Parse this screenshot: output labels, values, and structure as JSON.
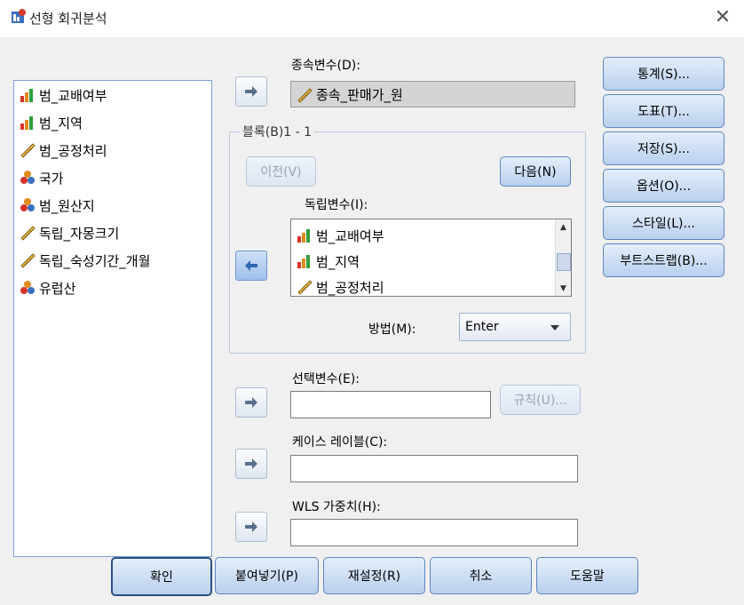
{
  "window": {
    "title": "선형 회귀분석",
    "close_glyph": "✕"
  },
  "source_variables": [
    {
      "label": "범_교배여부",
      "icon": "nominal-bar-icon"
    },
    {
      "label": "범_지역",
      "icon": "nominal-bar-icon"
    },
    {
      "label": "범_공정처리",
      "icon": "scale-ruler-icon"
    },
    {
      "label": "국가",
      "icon": "nominal-circles-icon"
    },
    {
      "label": "범_원산지",
      "icon": "nominal-circles-icon"
    },
    {
      "label": "독립_자몽크기",
      "icon": "scale-ruler-icon"
    },
    {
      "label": "독립_숙성기간_개월",
      "icon": "scale-ruler-icon"
    },
    {
      "label": "유럽산",
      "icon": "nominal-circles-icon"
    }
  ],
  "dependent": {
    "label": "종속변수(D):",
    "value": "종속_판매가_원"
  },
  "block": {
    "legend": "블록(B)1 - 1",
    "prev_label": "이전(V)",
    "next_label": "다음(N)",
    "independents_label": "독립변수(I):",
    "independents": [
      {
        "label": "범_교배여부",
        "icon": "nominal-bar-icon"
      },
      {
        "label": "범_지역",
        "icon": "nominal-bar-icon"
      },
      {
        "label": "범_공정처리",
        "icon": "scale-ruler-icon"
      }
    ],
    "method_label": "방법(M):",
    "method_value": "Enter"
  },
  "selection": {
    "label": "선택변수(E):",
    "value": "",
    "rule_label": "규칙(U)..."
  },
  "case_label": {
    "label": "케이스 레이블(C):",
    "value": ""
  },
  "wls": {
    "label": "WLS 가중치(H):",
    "value": ""
  },
  "side_buttons": [
    "통계(S)...",
    "도표(T)...",
    "저장(S)...",
    "옵션(O)...",
    "스타일(L)...",
    "부트스트랩(B)..."
  ],
  "bottom_buttons": [
    "확인",
    "붙여넣기(P)",
    "재설정(R)",
    "취소",
    "도움말"
  ],
  "colors": {
    "accent_border": "#5e86c0",
    "list_border": "#7a9fd6",
    "arrow_active": "#2f66b3"
  }
}
